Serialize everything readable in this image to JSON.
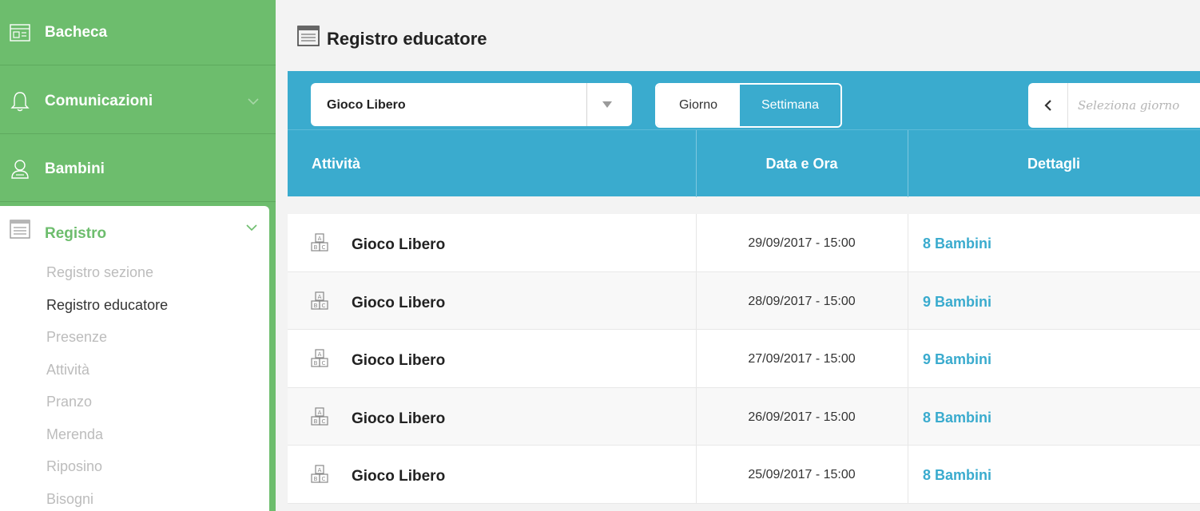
{
  "sidebar": {
    "items": [
      {
        "label": "Bacheca",
        "icon": "board-icon"
      },
      {
        "label": "Comunicazioni",
        "icon": "bell-icon"
      },
      {
        "label": "Bambini",
        "icon": "child-icon"
      }
    ],
    "registro": {
      "label": "Registro",
      "icon": "register-icon",
      "subitems": [
        "Registro sezione",
        "Registro educatore",
        "Presenze",
        "Attività",
        "Pranzo",
        "Merenda",
        "Riposino",
        "Bisogni"
      ],
      "active_subitem": "Registro educatore"
    }
  },
  "header": {
    "title": "Registro educatore",
    "icon": "register-icon"
  },
  "toolbar": {
    "activity_select": "Gioco Libero",
    "view_day": "Giorno",
    "view_week": "Settimana",
    "active_view": "Settimana",
    "date_placeholder": "Seleziona giorno"
  },
  "table": {
    "headers": [
      "Attività",
      "Data e Ora",
      "Dettagli"
    ],
    "rows": [
      {
        "activity": "Gioco Libero",
        "datetime": "29/09/2017 - 15:00",
        "details": "8 Bambini"
      },
      {
        "activity": "Gioco Libero",
        "datetime": "28/09/2017 - 15:00",
        "details": "9 Bambini"
      },
      {
        "activity": "Gioco Libero",
        "datetime": "27/09/2017 - 15:00",
        "details": "9 Bambini"
      },
      {
        "activity": "Gioco Libero",
        "datetime": "26/09/2017 - 15:00",
        "details": "8 Bambini"
      },
      {
        "activity": "Gioco Libero",
        "datetime": "25/09/2017 - 15:00",
        "details": "8 Bambini"
      }
    ]
  },
  "colors": {
    "sidebar_green": "#6dbd6d",
    "accent_blue": "#3aabce",
    "background": "#f3f3f3"
  }
}
